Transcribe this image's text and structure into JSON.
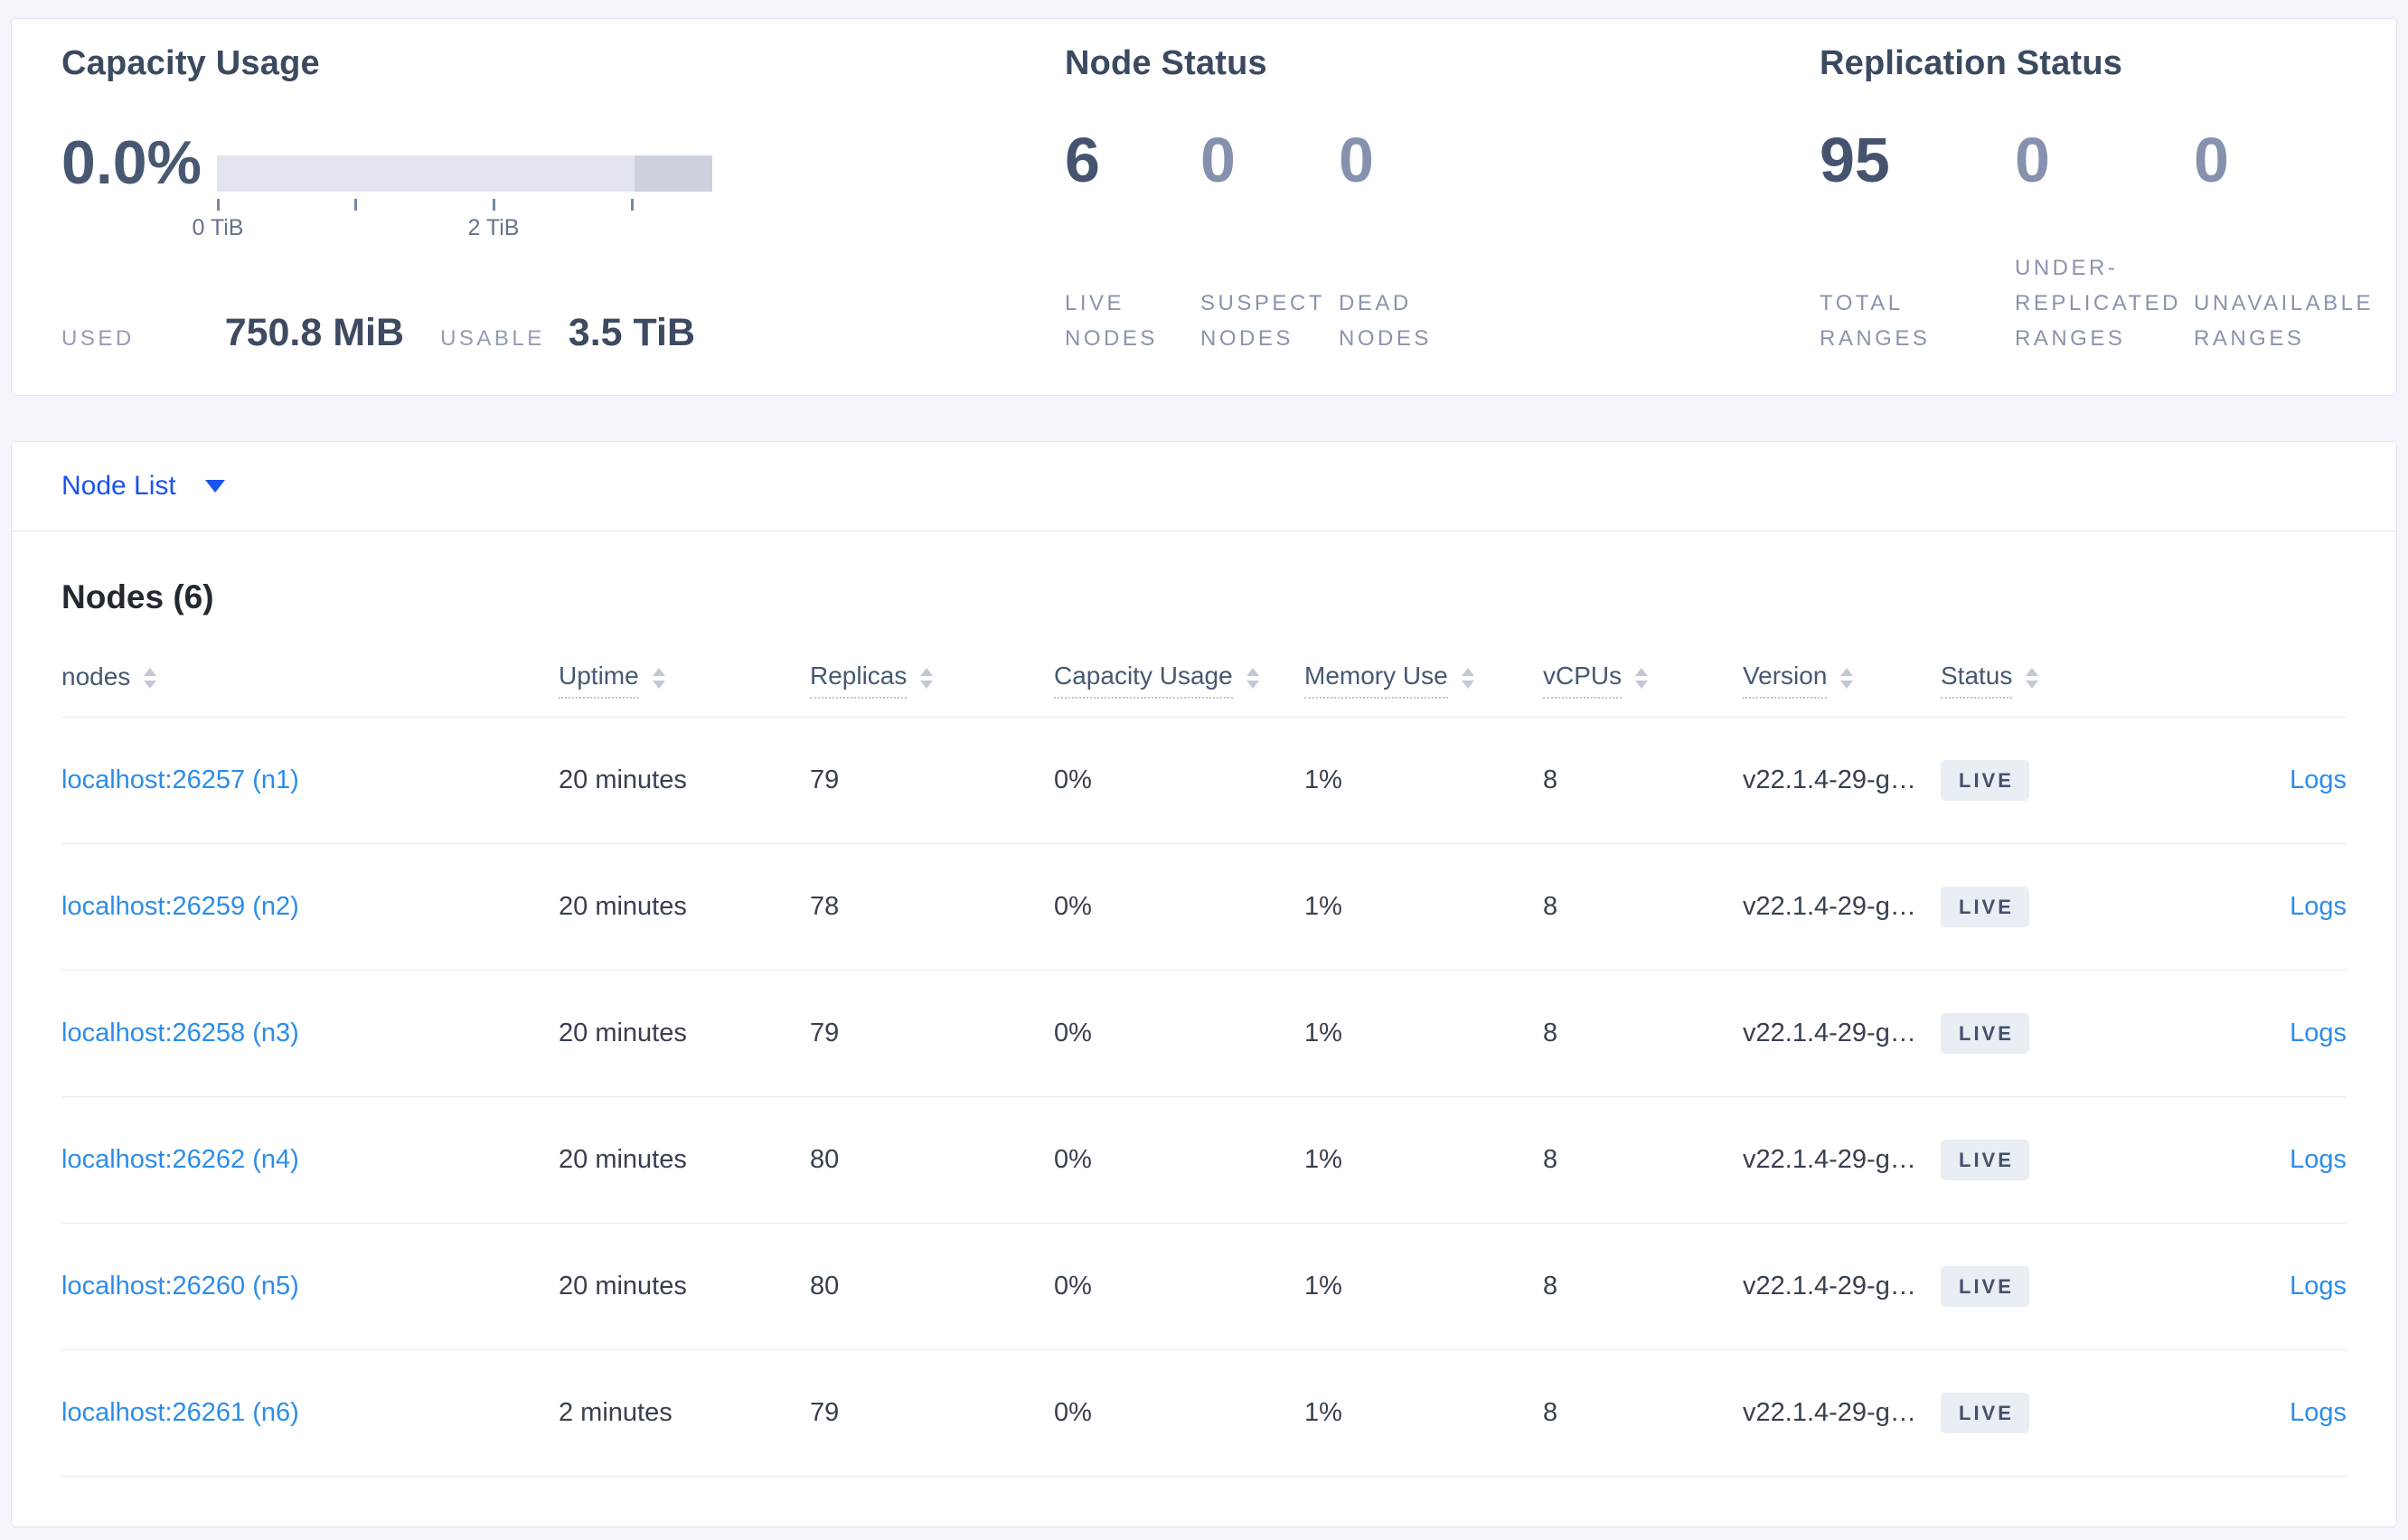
{
  "summary": {
    "capacity": {
      "title": "Capacity Usage",
      "percent": "0.0%",
      "tick_labels": [
        "0 TiB",
        "2 TiB"
      ],
      "used_label": "USED",
      "used_value": "750.8 MiB",
      "usable_label": "USABLE",
      "usable_value": "3.5 TiB"
    },
    "node_status": {
      "title": "Node Status",
      "stats": [
        {
          "value": "6",
          "label": "LIVE NODES"
        },
        {
          "value": "0",
          "label": "SUSPECT NODES"
        },
        {
          "value": "0",
          "label": "DEAD NODES"
        }
      ]
    },
    "replication": {
      "title": "Replication Status",
      "stats": [
        {
          "value": "95",
          "label": "TOTAL RANGES"
        },
        {
          "value": "0",
          "label": "UNDER-REPLICATED RANGES"
        },
        {
          "value": "0",
          "label": "UNAVAILABLE RANGES"
        }
      ]
    }
  },
  "node_list": {
    "dropdown_label": "Node List",
    "heading": "Nodes (6)",
    "columns": [
      "nodes",
      "Uptime",
      "Replicas",
      "Capacity Usage",
      "Memory Use",
      "vCPUs",
      "Version",
      "Status"
    ],
    "logs_label": "Logs",
    "rows": [
      {
        "node": "localhost:26257 (n1)",
        "uptime": "20 minutes",
        "replicas": "79",
        "capacity_usage": "0%",
        "memory_use": "1%",
        "vcpus": "8",
        "version": "v22.1.4-29-g…",
        "status": "LIVE"
      },
      {
        "node": "localhost:26259 (n2)",
        "uptime": "20 minutes",
        "replicas": "78",
        "capacity_usage": "0%",
        "memory_use": "1%",
        "vcpus": "8",
        "version": "v22.1.4-29-g…",
        "status": "LIVE"
      },
      {
        "node": "localhost:26258 (n3)",
        "uptime": "20 minutes",
        "replicas": "79",
        "capacity_usage": "0%",
        "memory_use": "1%",
        "vcpus": "8",
        "version": "v22.1.4-29-g…",
        "status": "LIVE"
      },
      {
        "node": "localhost:26262 (n4)",
        "uptime": "20 minutes",
        "replicas": "80",
        "capacity_usage": "0%",
        "memory_use": "1%",
        "vcpus": "8",
        "version": "v22.1.4-29-g…",
        "status": "LIVE"
      },
      {
        "node": "localhost:26260 (n5)",
        "uptime": "20 minutes",
        "replicas": "80",
        "capacity_usage": "0%",
        "memory_use": "1%",
        "vcpus": "8",
        "version": "v22.1.4-29-g…",
        "status": "LIVE"
      },
      {
        "node": "localhost:26261 (n6)",
        "uptime": "2 minutes",
        "replicas": "79",
        "capacity_usage": "0%",
        "memory_use": "1%",
        "vcpus": "8",
        "version": "v22.1.4-29-g…",
        "status": "LIVE"
      }
    ]
  },
  "colors": {
    "accent_blue": "#1a53f0",
    "link_blue": "#2b8de9",
    "stat_dark": "#46536e",
    "stat_light": "#8591ad",
    "badge_bg": "#e9edf4",
    "badge_text": "#44516b",
    "gauge_track": "#e2e5ef",
    "gauge_segment": "#cdd1dd"
  }
}
